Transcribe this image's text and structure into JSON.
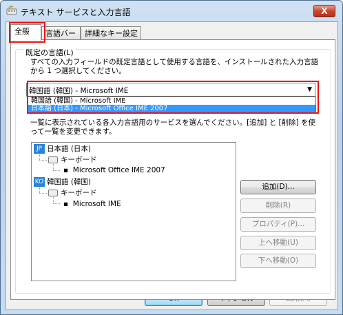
{
  "window": {
    "title": "テキスト サービスと入力言語",
    "close_label": "X"
  },
  "tabs": [
    {
      "label": "全般",
      "active": true
    },
    {
      "label": "言語バー",
      "active": false
    },
    {
      "label": "詳細なキー設定",
      "active": false
    }
  ],
  "default_language": {
    "group_label": "既定の言語(L)",
    "description_line1": "すべての入力フィールドの既定言語として使用する言語を、インストールされた入力言語",
    "description_line2": "から 1 つ選択してください。",
    "combo_value": "韓国語 (韓国) - Microsoft IME",
    "options": [
      {
        "label": "韓国語 (韓国) - Microsoft IME",
        "selected": false
      },
      {
        "label": "日本語 (日本) - Microsoft Office IME 2007",
        "selected": true
      }
    ]
  },
  "services": {
    "description_line1": "一覧に表示されている各入力言語用のサービスを選んでください。[追加] と [削除] を使",
    "description_line2": "って一覧を変更できます。",
    "tree": [
      {
        "badge": "JP",
        "language": "日本語 (日本)",
        "category": "キーボード",
        "item": "Microsoft Office IME 2007"
      },
      {
        "badge": "KO",
        "language": "韓国語 (韓国)",
        "category": "キーボード",
        "item": "Microsoft IME"
      }
    ],
    "buttons": {
      "add": "追加(D)...",
      "remove": "削除(R)",
      "properties": "プロパティ(P)...",
      "move_up": "上へ移動(U)",
      "move_down": "下へ移動(O)"
    }
  },
  "footer": {
    "ok": "OK",
    "cancel": "キャンセル",
    "apply": "適用(A)"
  },
  "colors": {
    "highlight": "#ee1111",
    "selection": "#3399ff"
  }
}
